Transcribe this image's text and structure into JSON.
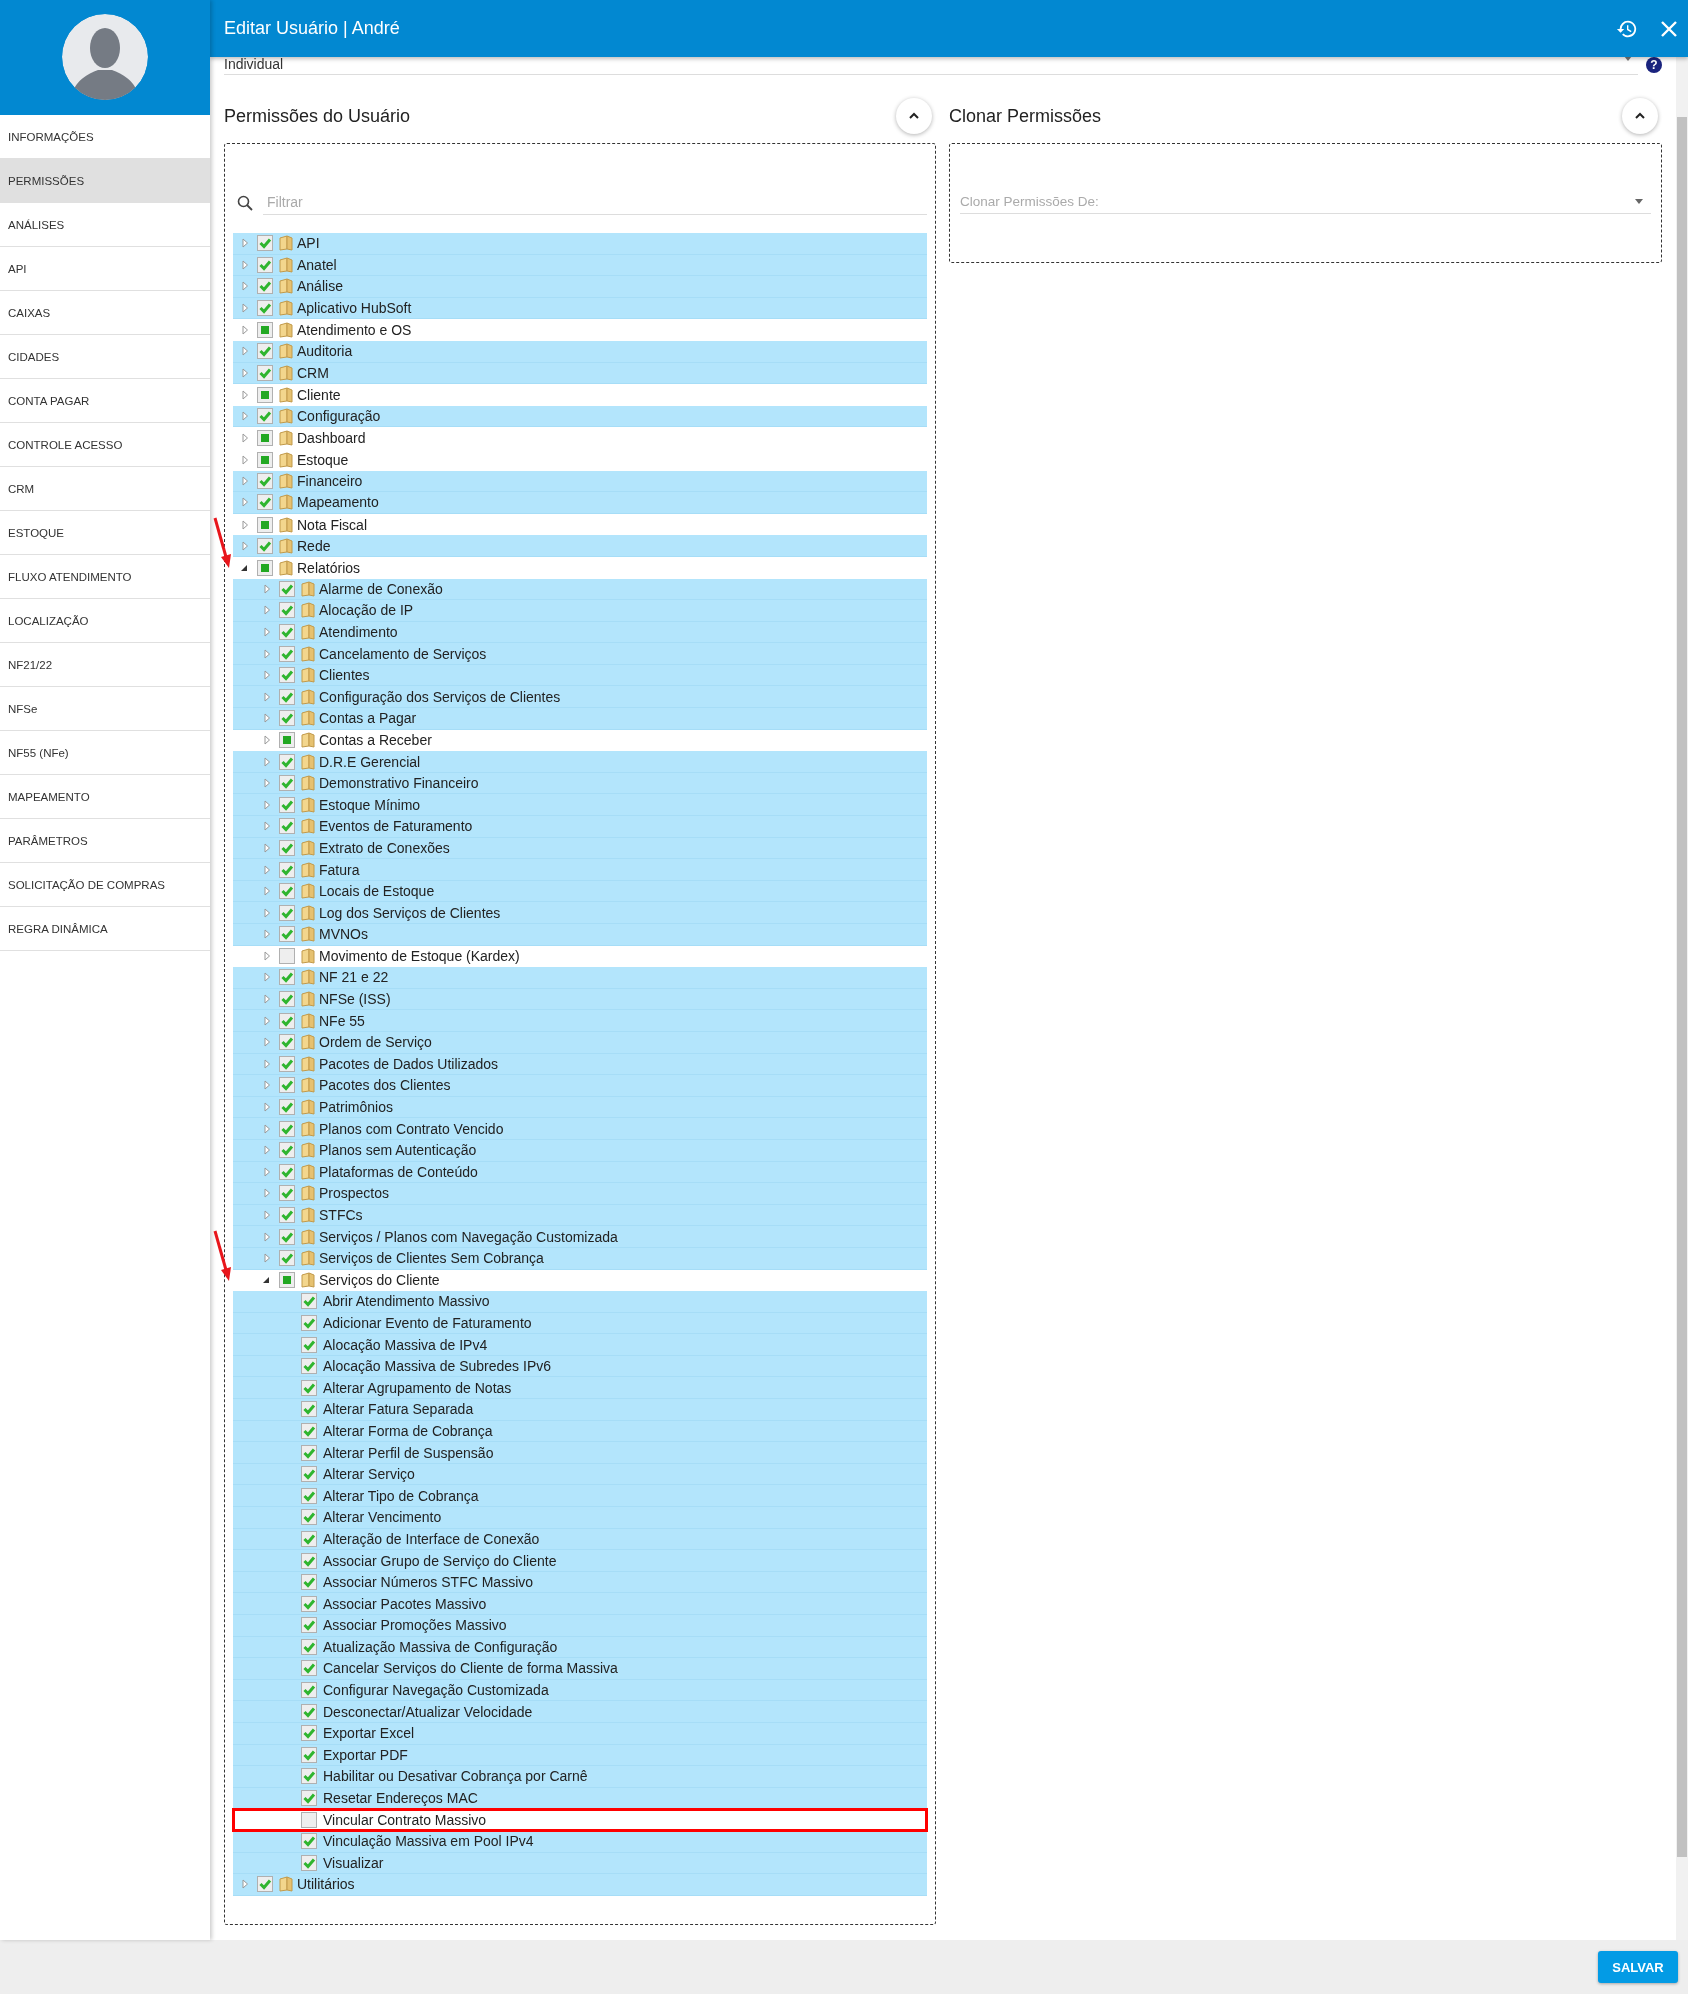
{
  "header": {
    "title": "Editar Usuário | André"
  },
  "sidebar": {
    "items": [
      {
        "label": "INFORMAÇÕES",
        "selected": false
      },
      {
        "label": "PERMISSÕES",
        "selected": true
      },
      {
        "label": "ANÁLISES",
        "selected": false
      },
      {
        "label": "API",
        "selected": false
      },
      {
        "label": "CAIXAS",
        "selected": false
      },
      {
        "label": "CIDADES",
        "selected": false
      },
      {
        "label": "CONTA PAGAR",
        "selected": false
      },
      {
        "label": "CONTROLE ACESSO",
        "selected": false
      },
      {
        "label": "CRM",
        "selected": false
      },
      {
        "label": "ESTOQUE",
        "selected": false
      },
      {
        "label": "FLUXO ATENDIMENTO",
        "selected": false
      },
      {
        "label": "LOCALIZAÇÃO",
        "selected": false
      },
      {
        "label": "NF21/22",
        "selected": false
      },
      {
        "label": "NFSe",
        "selected": false
      },
      {
        "label": "NF55 (NFe)",
        "selected": false
      },
      {
        "label": "MAPEAMENTO",
        "selected": false
      },
      {
        "label": "PARÂMETROS",
        "selected": false
      },
      {
        "label": "SOLICITAÇÃO DE COMPRAS",
        "selected": false
      },
      {
        "label": "REGRA DINÂMICA",
        "selected": false
      }
    ]
  },
  "profile_type": {
    "value": "Individual",
    "help": "?"
  },
  "permissions": {
    "title": "Permissões do Usuário",
    "filter": {
      "placeholder": "Filtrar"
    },
    "tree": [
      {
        "label": "API",
        "kind": "folder",
        "checked": true,
        "partial": false,
        "expanded": false,
        "pointed": false,
        "boxed": false
      },
      {
        "label": "Anatel",
        "kind": "folder",
        "checked": true,
        "partial": false,
        "expanded": false,
        "pointed": false,
        "boxed": false
      },
      {
        "label": "Análise",
        "kind": "folder",
        "checked": true,
        "partial": false,
        "expanded": false,
        "pointed": false,
        "boxed": false
      },
      {
        "label": "Aplicativo HubSoft",
        "kind": "folder",
        "checked": true,
        "partial": false,
        "expanded": false,
        "pointed": false,
        "boxed": false
      },
      {
        "label": "Atendimento e OS",
        "kind": "folder",
        "checked": false,
        "partial": true,
        "expanded": false,
        "pointed": false,
        "boxed": false
      },
      {
        "label": "Auditoria",
        "kind": "folder",
        "checked": true,
        "partial": false,
        "expanded": false,
        "pointed": false,
        "boxed": false
      },
      {
        "label": "CRM",
        "kind": "folder",
        "checked": true,
        "partial": false,
        "expanded": false,
        "pointed": false,
        "boxed": false
      },
      {
        "label": "Cliente",
        "kind": "folder",
        "checked": false,
        "partial": true,
        "expanded": false,
        "pointed": false,
        "boxed": false
      },
      {
        "label": "Configuração",
        "kind": "folder",
        "checked": true,
        "partial": false,
        "expanded": false,
        "pointed": false,
        "boxed": false
      },
      {
        "label": "Dashboard",
        "kind": "folder",
        "checked": false,
        "partial": true,
        "expanded": false,
        "pointed": false,
        "boxed": false
      },
      {
        "label": "Estoque",
        "kind": "folder",
        "checked": false,
        "partial": true,
        "expanded": false,
        "pointed": false,
        "boxed": false
      },
      {
        "label": "Financeiro",
        "kind": "folder",
        "checked": true,
        "partial": false,
        "expanded": false,
        "pointed": false,
        "boxed": false
      },
      {
        "label": "Mapeamento",
        "kind": "folder",
        "checked": true,
        "partial": false,
        "expanded": false,
        "pointed": false,
        "boxed": false
      },
      {
        "label": "Nota Fiscal",
        "kind": "folder",
        "checked": false,
        "partial": true,
        "expanded": false,
        "pointed": false,
        "boxed": false
      },
      {
        "label": "Rede",
        "kind": "folder",
        "checked": true,
        "partial": false,
        "expanded": false,
        "pointed": false,
        "boxed": false
      },
      {
        "label": "Relatórios",
        "kind": "folder",
        "checked": false,
        "partial": true,
        "expanded": true,
        "pointed": true,
        "boxed": false,
        "children": [
          {
            "label": "Alarme de Conexão",
            "kind": "folder",
            "checked": true,
            "partial": false,
            "expanded": false,
            "pointed": false,
            "boxed": false
          },
          {
            "label": "Alocação de IP",
            "kind": "folder",
            "checked": true,
            "partial": false,
            "expanded": false,
            "pointed": false,
            "boxed": false
          },
          {
            "label": "Atendimento",
            "kind": "folder",
            "checked": true,
            "partial": false,
            "expanded": false,
            "pointed": false,
            "boxed": false
          },
          {
            "label": "Cancelamento de Serviços",
            "kind": "folder",
            "checked": true,
            "partial": false,
            "expanded": false,
            "pointed": false,
            "boxed": false
          },
          {
            "label": "Clientes",
            "kind": "folder",
            "checked": true,
            "partial": false,
            "expanded": false,
            "pointed": false,
            "boxed": false
          },
          {
            "label": "Configuração dos Serviços de Clientes",
            "kind": "folder",
            "checked": true,
            "partial": false,
            "expanded": false,
            "pointed": false,
            "boxed": false
          },
          {
            "label": "Contas a Pagar",
            "kind": "folder",
            "checked": true,
            "partial": false,
            "expanded": false,
            "pointed": false,
            "boxed": false
          },
          {
            "label": "Contas a Receber",
            "kind": "folder",
            "checked": false,
            "partial": true,
            "expanded": false,
            "pointed": false,
            "boxed": false
          },
          {
            "label": "D.R.E Gerencial",
            "kind": "folder",
            "checked": true,
            "partial": false,
            "expanded": false,
            "pointed": false,
            "boxed": false
          },
          {
            "label": "Demonstrativo Financeiro",
            "kind": "folder",
            "checked": true,
            "partial": false,
            "expanded": false,
            "pointed": false,
            "boxed": false
          },
          {
            "label": "Estoque Mínimo",
            "kind": "folder",
            "checked": true,
            "partial": false,
            "expanded": false,
            "pointed": false,
            "boxed": false
          },
          {
            "label": "Eventos de Faturamento",
            "kind": "folder",
            "checked": true,
            "partial": false,
            "expanded": false,
            "pointed": false,
            "boxed": false
          },
          {
            "label": "Extrato de Conexões",
            "kind": "folder",
            "checked": true,
            "partial": false,
            "expanded": false,
            "pointed": false,
            "boxed": false
          },
          {
            "label": "Fatura",
            "kind": "folder",
            "checked": true,
            "partial": false,
            "expanded": false,
            "pointed": false,
            "boxed": false
          },
          {
            "label": "Locais de Estoque",
            "kind": "folder",
            "checked": true,
            "partial": false,
            "expanded": false,
            "pointed": false,
            "boxed": false
          },
          {
            "label": "Log dos Serviços de Clientes",
            "kind": "folder",
            "checked": true,
            "partial": false,
            "expanded": false,
            "pointed": false,
            "boxed": false
          },
          {
            "label": "MVNOs",
            "kind": "folder",
            "checked": true,
            "partial": false,
            "expanded": false,
            "pointed": false,
            "boxed": false
          },
          {
            "label": "Movimento de Estoque (Kardex)",
            "kind": "folder",
            "checked": false,
            "partial": false,
            "expanded": false,
            "pointed": false,
            "boxed": false
          },
          {
            "label": "NF 21 e 22",
            "kind": "folder",
            "checked": true,
            "partial": false,
            "expanded": false,
            "pointed": false,
            "boxed": false
          },
          {
            "label": "NFSe (ISS)",
            "kind": "folder",
            "checked": true,
            "partial": false,
            "expanded": false,
            "pointed": false,
            "boxed": false
          },
          {
            "label": "NFe 55",
            "kind": "folder",
            "checked": true,
            "partial": false,
            "expanded": false,
            "pointed": false,
            "boxed": false
          },
          {
            "label": "Ordem de Serviço",
            "kind": "folder",
            "checked": true,
            "partial": false,
            "expanded": false,
            "pointed": false,
            "boxed": false
          },
          {
            "label": "Pacotes de Dados Utilizados",
            "kind": "folder",
            "checked": true,
            "partial": false,
            "expanded": false,
            "pointed": false,
            "boxed": false
          },
          {
            "label": "Pacotes dos Clientes",
            "kind": "folder",
            "checked": true,
            "partial": false,
            "expanded": false,
            "pointed": false,
            "boxed": false
          },
          {
            "label": "Patrimônios",
            "kind": "folder",
            "checked": true,
            "partial": false,
            "expanded": false,
            "pointed": false,
            "boxed": false
          },
          {
            "label": "Planos com Contrato Vencido",
            "kind": "folder",
            "checked": true,
            "partial": false,
            "expanded": false,
            "pointed": false,
            "boxed": false
          },
          {
            "label": "Planos sem Autenticação",
            "kind": "folder",
            "checked": true,
            "partial": false,
            "expanded": false,
            "pointed": false,
            "boxed": false
          },
          {
            "label": "Plataformas de Conteúdo",
            "kind": "folder",
            "checked": true,
            "partial": false,
            "expanded": false,
            "pointed": false,
            "boxed": false
          },
          {
            "label": "Prospectos",
            "kind": "folder",
            "checked": true,
            "partial": false,
            "expanded": false,
            "pointed": false,
            "boxed": false
          },
          {
            "label": "STFCs",
            "kind": "folder",
            "checked": true,
            "partial": false,
            "expanded": false,
            "pointed": false,
            "boxed": false
          },
          {
            "label": "Serviços / Planos com Navegação Customizada",
            "kind": "folder",
            "checked": true,
            "partial": false,
            "expanded": false,
            "pointed": false,
            "boxed": false
          },
          {
            "label": "Serviços de Clientes Sem Cobrança",
            "kind": "folder",
            "checked": true,
            "partial": false,
            "expanded": false,
            "pointed": false,
            "boxed": false
          },
          {
            "label": "Serviços do Cliente",
            "kind": "folder",
            "checked": false,
            "partial": true,
            "expanded": true,
            "pointed": true,
            "boxed": false,
            "children": [
              {
                "label": "Abrir Atendimento Massivo",
                "kind": "permission",
                "checked": true,
                "partial": false,
                "pointed": false,
                "boxed": false
              },
              {
                "label": "Adicionar Evento de Faturamento",
                "kind": "permission",
                "checked": true,
                "partial": false,
                "pointed": false,
                "boxed": false
              },
              {
                "label": "Alocação Massiva de IPv4",
                "kind": "permission",
                "checked": true,
                "partial": false,
                "pointed": false,
                "boxed": false
              },
              {
                "label": "Alocação Massiva de Subredes IPv6",
                "kind": "permission",
                "checked": true,
                "partial": false,
                "pointed": false,
                "boxed": false
              },
              {
                "label": "Alterar Agrupamento de Notas",
                "kind": "permission",
                "checked": true,
                "partial": false,
                "pointed": false,
                "boxed": false
              },
              {
                "label": "Alterar Fatura Separada",
                "kind": "permission",
                "checked": true,
                "partial": false,
                "pointed": false,
                "boxed": false
              },
              {
                "label": "Alterar Forma de Cobrança",
                "kind": "permission",
                "checked": true,
                "partial": false,
                "pointed": false,
                "boxed": false
              },
              {
                "label": "Alterar Perfil de Suspensão",
                "kind": "permission",
                "checked": true,
                "partial": false,
                "pointed": false,
                "boxed": false
              },
              {
                "label": "Alterar Serviço",
                "kind": "permission",
                "checked": true,
                "partial": false,
                "pointed": false,
                "boxed": false
              },
              {
                "label": "Alterar Tipo de Cobrança",
                "kind": "permission",
                "checked": true,
                "partial": false,
                "pointed": false,
                "boxed": false
              },
              {
                "label": "Alterar Vencimento",
                "kind": "permission",
                "checked": true,
                "partial": false,
                "pointed": false,
                "boxed": false
              },
              {
                "label": "Alteração de Interface de Conexão",
                "kind": "permission",
                "checked": true,
                "partial": false,
                "pointed": false,
                "boxed": false
              },
              {
                "label": "Associar Grupo de Serviço do Cliente",
                "kind": "permission",
                "checked": true,
                "partial": false,
                "pointed": false,
                "boxed": false
              },
              {
                "label": "Associar Números STFC Massivo",
                "kind": "permission",
                "checked": true,
                "partial": false,
                "pointed": false,
                "boxed": false
              },
              {
                "label": "Associar Pacotes Massivo",
                "kind": "permission",
                "checked": true,
                "partial": false,
                "pointed": false,
                "boxed": false
              },
              {
                "label": "Associar Promoções Massivo",
                "kind": "permission",
                "checked": true,
                "partial": false,
                "pointed": false,
                "boxed": false
              },
              {
                "label": "Atualização Massiva de Configuração",
                "kind": "permission",
                "checked": true,
                "partial": false,
                "pointed": false,
                "boxed": false
              },
              {
                "label": "Cancelar Serviços do Cliente de forma Massiva",
                "kind": "permission",
                "checked": true,
                "partial": false,
                "pointed": false,
                "boxed": false
              },
              {
                "label": "Configurar Navegação Customizada",
                "kind": "permission",
                "checked": true,
                "partial": false,
                "pointed": false,
                "boxed": false
              },
              {
                "label": "Desconectar/Atualizar Velocidade",
                "kind": "permission",
                "checked": true,
                "partial": false,
                "pointed": false,
                "boxed": false
              },
              {
                "label": "Exportar Excel",
                "kind": "permission",
                "checked": true,
                "partial": false,
                "pointed": false,
                "boxed": false
              },
              {
                "label": "Exportar PDF",
                "kind": "permission",
                "checked": true,
                "partial": false,
                "pointed": false,
                "boxed": false
              },
              {
                "label": "Habilitar ou Desativar Cobrança por Carnê",
                "kind": "permission",
                "checked": true,
                "partial": false,
                "pointed": false,
                "boxed": false
              },
              {
                "label": "Resetar Endereços MAC",
                "kind": "permission",
                "checked": true,
                "partial": false,
                "pointed": false,
                "boxed": false
              },
              {
                "label": "Vincular Contrato Massivo",
                "kind": "permission",
                "checked": false,
                "partial": false,
                "pointed": false,
                "boxed": true
              },
              {
                "label": "Vinculação Massiva em Pool IPv4",
                "kind": "permission",
                "checked": true,
                "partial": false,
                "pointed": false,
                "boxed": false
              },
              {
                "label": "Visualizar",
                "kind": "permission",
                "checked": true,
                "partial": false,
                "pointed": false,
                "boxed": false
              }
            ]
          }
        ]
      },
      {
        "label": "Utilitários",
        "kind": "folder",
        "checked": true,
        "partial": false,
        "expanded": false,
        "pointed": false,
        "boxed": false
      }
    ]
  },
  "clone": {
    "title": "Clonar Permissões",
    "select": {
      "placeholder": "Clonar Permissões De:"
    }
  },
  "footer": {
    "save": "SALVAR"
  }
}
